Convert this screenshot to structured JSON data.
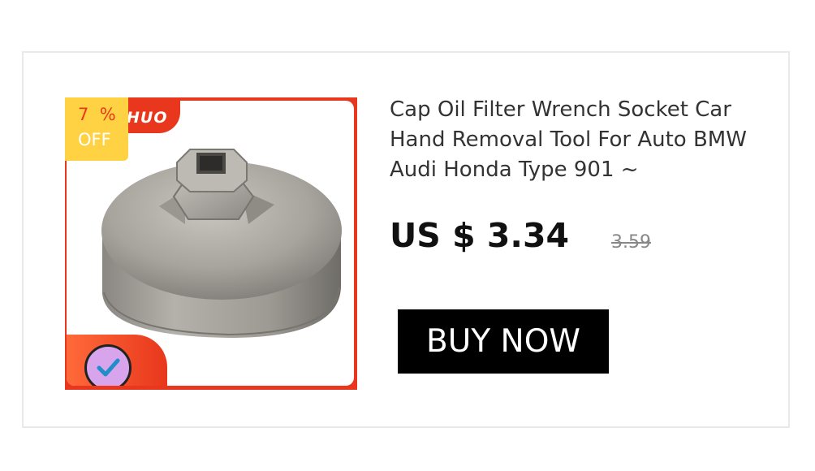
{
  "product": {
    "brand_partial": "HUO",
    "discount_value": "7  %",
    "discount_off": "OFF",
    "title": "Cap Oil Filter Wrench Socket Car Hand Removal Tool For Auto BMW Audi Honda Type 901 ~",
    "price": "US $ 3.34",
    "original_price": "3.59",
    "buy_label": "BUY NOW"
  },
  "colors": {
    "frame_red": "#e8371c",
    "badge_yellow": "#ffd243",
    "button_black": "#000000"
  },
  "icons": {
    "check_badge": "check-circle-icon"
  }
}
